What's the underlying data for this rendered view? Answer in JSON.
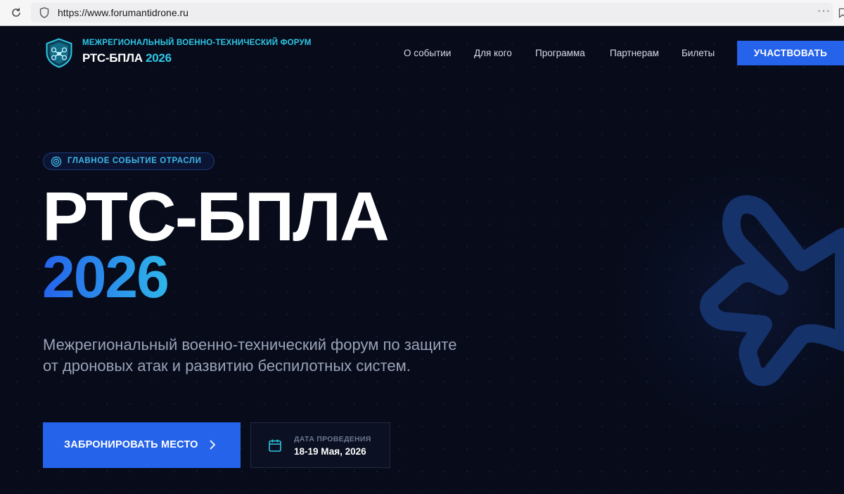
{
  "browser": {
    "url": "https://www.forumantidrone.ru",
    "menu_glyph": "···"
  },
  "header": {
    "subtitle": "МЕЖРЕГИОНАЛЬНЫЙ ВОЕННО-ТЕХНИЧЕСКИЙ ФОРУМ",
    "title": "РТС-БПЛА",
    "title_year": "2026",
    "nav": [
      {
        "label": "О событии"
      },
      {
        "label": "Для кого"
      },
      {
        "label": "Программа"
      },
      {
        "label": "Партнерам"
      },
      {
        "label": "Билеты"
      }
    ],
    "cta_label": "УЧАСТВОВАТЬ"
  },
  "hero": {
    "badge": "ГЛАВНОЕ СОБЫТИЕ ОТРАСЛИ",
    "title": "РТС-БПЛА",
    "year": "2026",
    "description": "Межрегиональный военно-технический форум по защите от дроновых атак и развитию беспилотных систем.",
    "book_button": "ЗАБРОНИРОВАТЬ МЕСТО",
    "date_label": "ДАТА ПРОВЕДЕНИЯ",
    "date_value": "18-19 Мая, 2026"
  },
  "colors": {
    "accent": "#2563eb",
    "cyan": "#2fc7e6",
    "background": "#070b1a"
  },
  "icons": {
    "reload": "reload-icon",
    "site_info": "shield-icon",
    "bookmark": "bookmark-icon",
    "logo": "drone-shield-logo",
    "badge": "target-icon",
    "arrow": "chevron-right-icon",
    "calendar": "calendar-icon",
    "decor": "drone-silhouette"
  }
}
